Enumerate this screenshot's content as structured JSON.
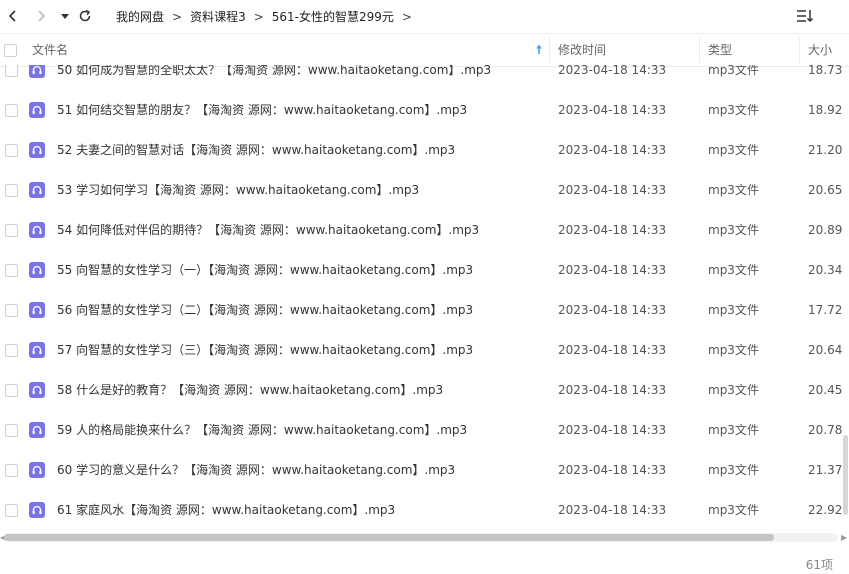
{
  "breadcrumb": {
    "items": [
      "我的网盘",
      "资料课程3",
      "561-女性的智慧299元"
    ],
    "separator": ">"
  },
  "columns": {
    "name": "文件名",
    "modified": "修改时间",
    "type": "类型",
    "size": "大小"
  },
  "files": [
    {
      "name": "50 如何成为智慧的全职太太？【海淘资 源网：www.haitaoketang.com】.mp3",
      "modified": "2023-04-18 14:33",
      "type": "mp3文件",
      "size": "18.73"
    },
    {
      "name": "51 如何结交智慧的朋友？【海淘资 源网：www.haitaoketang.com】.mp3",
      "modified": "2023-04-18 14:33",
      "type": "mp3文件",
      "size": "18.92"
    },
    {
      "name": "52 夫妻之间的智慧对话【海淘资 源网：www.haitaoketang.com】.mp3",
      "modified": "2023-04-18 14:33",
      "type": "mp3文件",
      "size": "21.20"
    },
    {
      "name": "53 学习如何学习【海淘资 源网：www.haitaoketang.com】.mp3",
      "modified": "2023-04-18 14:33",
      "type": "mp3文件",
      "size": "20.65"
    },
    {
      "name": "54 如何降低对伴侣的期待？【海淘资 源网：www.haitaoketang.com】.mp3",
      "modified": "2023-04-18 14:33",
      "type": "mp3文件",
      "size": "20.89"
    },
    {
      "name": "55 向智慧的女性学习（一）【海淘资 源网：www.haitaoketang.com】.mp3",
      "modified": "2023-04-18 14:33",
      "type": "mp3文件",
      "size": "20.34"
    },
    {
      "name": "56 向智慧的女性学习（二）【海淘资 源网：www.haitaoketang.com】.mp3",
      "modified": "2023-04-18 14:33",
      "type": "mp3文件",
      "size": "17.72"
    },
    {
      "name": "57 向智慧的女性学习（三）【海淘资 源网：www.haitaoketang.com】.mp3",
      "modified": "2023-04-18 14:33",
      "type": "mp3文件",
      "size": "20.64"
    },
    {
      "name": "58 什么是好的教育？【海淘资 源网：www.haitaoketang.com】.mp3",
      "modified": "2023-04-18 14:33",
      "type": "mp3文件",
      "size": "20.45"
    },
    {
      "name": "59 人的格局能换来什么？【海淘资 源网：www.haitaoketang.com】.mp3",
      "modified": "2023-04-18 14:33",
      "type": "mp3文件",
      "size": "20.78"
    },
    {
      "name": "60 学习的意义是什么？【海淘资 源网：www.haitaoketang.com】.mp3",
      "modified": "2023-04-18 14:33",
      "type": "mp3文件",
      "size": "21.37"
    },
    {
      "name": "61 家庭风水【海淘资 源网：www.haitaoketang.com】.mp3",
      "modified": "2023-04-18 14:33",
      "type": "mp3文件",
      "size": "22.92"
    }
  ],
  "footer": {
    "count": "61项"
  },
  "colors": {
    "sort_arrow": "#4a9ff5",
    "file_icon": "#7b74e8"
  }
}
